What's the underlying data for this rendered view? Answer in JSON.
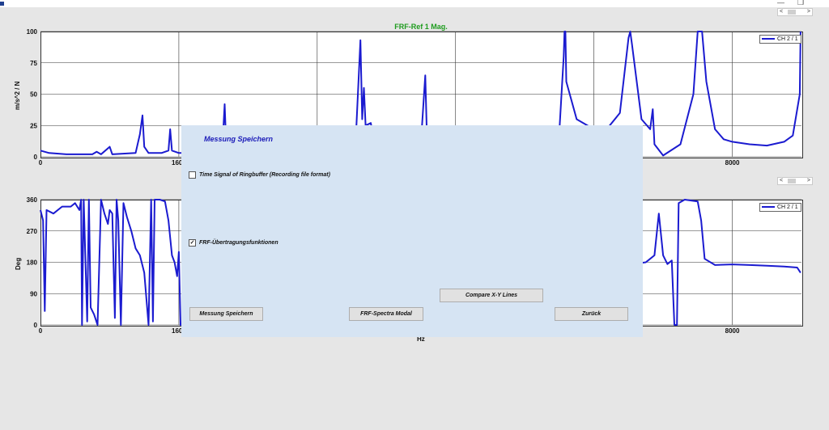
{
  "window": {
    "minimize_glyph": "—",
    "restore_glyph": "❐",
    "scroll_left_glyph": "<",
    "scroll_right_glyph": ">"
  },
  "colors": {
    "series": "#1b1bd0",
    "title": "#1e9c1e",
    "dialog_bg": "#d6e4f3",
    "dialog_title": "#1b1bb8"
  },
  "chart_data": [
    {
      "type": "line",
      "title": "FRF-Ref 1 Mag.",
      "ylabel": "m/s^2 / N",
      "xlabel": "",
      "xlim": [
        0,
        8800
      ],
      "ylim": [
        0,
        100
      ],
      "yticks": [
        "0",
        "25",
        "50",
        "75",
        "100"
      ],
      "xticks": [
        "0",
        "1600",
        "8000"
      ],
      "legend": "top-right",
      "series": [
        {
          "name": "CH 2 / 1",
          "points": [
            [
              0,
              5
            ],
            [
              100,
              3
            ],
            [
              300,
              2
            ],
            [
              500,
              2
            ],
            [
              600,
              2
            ],
            [
              650,
              4
            ],
            [
              700,
              2
            ],
            [
              800,
              8
            ],
            [
              830,
              2
            ],
            [
              1100,
              3
            ],
            [
              1150,
              18
            ],
            [
              1180,
              33
            ],
            [
              1200,
              8
            ],
            [
              1250,
              3
            ],
            [
              1400,
              3
            ],
            [
              1480,
              5
            ],
            [
              1500,
              22
            ],
            [
              1520,
              5
            ],
            [
              1600,
              3
            ],
            [
              1800,
              3
            ],
            [
              2100,
              3
            ],
            [
              2130,
              42
            ],
            [
              2150,
              4
            ],
            [
              2400,
              3
            ],
            [
              3600,
              4
            ],
            [
              3650,
              20
            ],
            [
              3700,
              93
            ],
            [
              3720,
              30
            ],
            [
              3740,
              55
            ],
            [
              3760,
              25
            ],
            [
              3820,
              27
            ],
            [
              3850,
              15
            ],
            [
              3950,
              18
            ],
            [
              4200,
              15
            ],
            [
              4400,
              12
            ],
            [
              4450,
              65
            ],
            [
              4470,
              12
            ],
            [
              5000,
              10
            ],
            [
              5500,
              10
            ],
            [
              6000,
              20
            ],
            [
              6050,
              80
            ],
            [
              6060,
              100
            ],
            [
              6070,
              100
            ],
            [
              6080,
              60
            ],
            [
              6200,
              30
            ],
            [
              6500,
              18
            ],
            [
              6700,
              35
            ],
            [
              6800,
              95
            ],
            [
              6820,
              100
            ],
            [
              6840,
              90
            ],
            [
              6950,
              30
            ],
            [
              7050,
              22
            ],
            [
              7080,
              38
            ],
            [
              7100,
              10
            ],
            [
              7200,
              1
            ],
            [
              7400,
              10
            ],
            [
              7550,
              50
            ],
            [
              7600,
              100
            ],
            [
              7650,
              100
            ],
            [
              7700,
              60
            ],
            [
              7800,
              22
            ],
            [
              7900,
              14
            ],
            [
              8000,
              12
            ],
            [
              8200,
              10
            ],
            [
              8400,
              9
            ],
            [
              8600,
              12
            ],
            [
              8700,
              17
            ],
            [
              8780,
              50
            ],
            [
              8790,
              100
            ]
          ]
        }
      ]
    },
    {
      "type": "line",
      "title": "",
      "ylabel": "Deg",
      "xlabel": "Hz",
      "xlim": [
        0,
        8800
      ],
      "ylim": [
        0,
        360
      ],
      "yticks": [
        "0",
        "90",
        "180",
        "270",
        "360"
      ],
      "xticks": [
        "0",
        "1600",
        "8000"
      ],
      "legend": "top-right",
      "series": [
        {
          "name": "CH 2 / 1",
          "points": [
            [
              0,
              330
            ],
            [
              30,
              300
            ],
            [
              50,
              40
            ],
            [
              70,
              330
            ],
            [
              150,
              320
            ],
            [
              250,
              340
            ],
            [
              350,
              340
            ],
            [
              400,
              350
            ],
            [
              450,
              330
            ],
            [
              470,
              360
            ],
            [
              480,
              0
            ],
            [
              500,
              360
            ],
            [
              540,
              10
            ],
            [
              560,
              360
            ],
            [
              580,
              50
            ],
            [
              620,
              30
            ],
            [
              660,
              0
            ],
            [
              700,
              360
            ],
            [
              740,
              320
            ],
            [
              780,
              290
            ],
            [
              800,
              330
            ],
            [
              830,
              320
            ],
            [
              860,
              20
            ],
            [
              880,
              360
            ],
            [
              900,
              300
            ],
            [
              930,
              0
            ],
            [
              960,
              350
            ],
            [
              1000,
              310
            ],
            [
              1050,
              270
            ],
            [
              1100,
              220
            ],
            [
              1150,
              200
            ],
            [
              1200,
              150
            ],
            [
              1250,
              0
            ],
            [
              1280,
              360
            ],
            [
              1300,
              10
            ],
            [
              1320,
              360
            ],
            [
              1380,
              360
            ],
            [
              1440,
              355
            ],
            [
              1480,
              300
            ],
            [
              1520,
              200
            ],
            [
              1550,
              180
            ],
            [
              1580,
              140
            ],
            [
              1600,
              210
            ],
            [
              1620,
              0
            ],
            [
              7000,
              180
            ],
            [
              7050,
              190
            ],
            [
              7100,
              200
            ],
            [
              7150,
              320
            ],
            [
              7200,
              200
            ],
            [
              7250,
              175
            ],
            [
              7300,
              185
            ],
            [
              7330,
              0
            ],
            [
              7360,
              0
            ],
            [
              7380,
              350
            ],
            [
              7450,
              360
            ],
            [
              7600,
              355
            ],
            [
              7640,
              300
            ],
            [
              7680,
              190
            ],
            [
              7800,
              172
            ],
            [
              8000,
              174
            ],
            [
              8200,
              172
            ],
            [
              8400,
              170
            ],
            [
              8600,
              168
            ],
            [
              8750,
              165
            ],
            [
              8790,
              150
            ]
          ]
        }
      ]
    }
  ],
  "dialog": {
    "title": "Messung Speichern",
    "time_signal_label": "Time  Signal of Ringbuffer (Recording file format)",
    "time_signal_checked": false,
    "frf_label": "FRF-Übertragungsfunktionen",
    "frf_checked": true,
    "check_glyph": "✓",
    "buttons": {
      "compare": "Compare X-Y Lines",
      "save": "Messung Speichern",
      "frf_modal": "FRF-Spectra Modal",
      "back": "Zurück"
    }
  }
}
